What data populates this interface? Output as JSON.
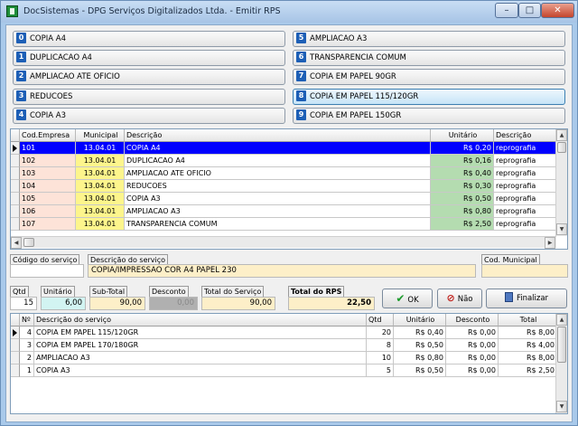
{
  "window": {
    "title": "DocSistemas - DPG Serviços Digitalizados Ltda. - Emitir RPS",
    "min_glyph": "–",
    "max_glyph": "□",
    "close_glyph": "✕"
  },
  "service_buttons": [
    {
      "num": "0",
      "label": "COPIA A4"
    },
    {
      "num": "1",
      "label": "DUPLICACAO A4"
    },
    {
      "num": "2",
      "label": "AMPLIACAO ATE OFICIO"
    },
    {
      "num": "3",
      "label": "REDUCOES"
    },
    {
      "num": "4",
      "label": "COPIA A3"
    },
    {
      "num": "5",
      "label": "AMPLIACAO A3"
    },
    {
      "num": "6",
      "label": "TRANSPARENCIA COMUM"
    },
    {
      "num": "7",
      "label": "COPIA EM PAPEL 90GR"
    },
    {
      "num": "8",
      "label": "COPIA EM PAPEL 115/120GR"
    },
    {
      "num": "9",
      "label": "COPIA EM PAPEL 150GR"
    }
  ],
  "services_grid": {
    "headers": [
      "Cod.Empresa",
      "Municipal",
      "Descrição",
      "Unitário",
      "Descrição"
    ],
    "rows": [
      {
        "cod": "101",
        "mun": "13.04.01",
        "desc": "COPIA A4",
        "unit": "R$ 0,20",
        "cat": "reprografia"
      },
      {
        "cod": "102",
        "mun": "13.04.01",
        "desc": "DUPLICACAO A4",
        "unit": "R$ 0,16",
        "cat": "reprografia"
      },
      {
        "cod": "103",
        "mun": "13.04.01",
        "desc": "AMPLIACAO ATE OFICIO",
        "unit": "R$ 0,40",
        "cat": "reprografia"
      },
      {
        "cod": "104",
        "mun": "13.04.01",
        "desc": "REDUCOES",
        "unit": "R$ 0,30",
        "cat": "reprografia"
      },
      {
        "cod": "105",
        "mun": "13.04.01",
        "desc": "COPIA A3",
        "unit": "R$ 0,50",
        "cat": "reprografia"
      },
      {
        "cod": "106",
        "mun": "13.04.01",
        "desc": "AMPLIACAO A3",
        "unit": "R$ 0,80",
        "cat": "reprografia"
      },
      {
        "cod": "107",
        "mun": "13.04.01",
        "desc": "TRANSPARENCIA COMUM",
        "unit": "R$ 2,50",
        "cat": "reprografia"
      }
    ]
  },
  "form": {
    "codigo_label": "Código do serviço",
    "codigo_value": "",
    "descricao_label": "Descrição do serviço",
    "descricao_value": "COPIA/IMPRESSAO COR A4 PAPEL 230",
    "cod_municipal_label": "Cod. Municipal",
    "cod_municipal_value": "",
    "qtd_label": "Qtd",
    "qtd_value": "15",
    "unitario_label": "Unitário",
    "unitario_value": "6,00",
    "subtotal_label": "Sub-Total",
    "subtotal_value": "90,00",
    "desconto_label": "Desconto",
    "desconto_value": "0,00",
    "total_servico_label": "Total do Serviço",
    "total_servico_value": "90,00",
    "total_rps_label": "Total do RPS",
    "total_rps_value": "22,50"
  },
  "actions": {
    "ok": "OK",
    "nao": "Não",
    "finalizar": "Finalizar"
  },
  "items_grid": {
    "headers": [
      "Nº",
      "Descrição do serviço",
      "Qtd",
      "Unitário",
      "Desconto",
      "Total"
    ],
    "rows": [
      {
        "n": "4",
        "desc": "COPIA EM PAPEL 115/120GR",
        "qtd": "20",
        "unit": "R$ 0,40",
        "desc_val": "R$ 0,00",
        "total": "R$ 8,00"
      },
      {
        "n": "3",
        "desc": "COPIA EM PAPEL 170/180GR",
        "qtd": "8",
        "unit": "R$ 0,50",
        "desc_val": "R$ 0,00",
        "total": "R$ 4,00"
      },
      {
        "n": "2",
        "desc": "AMPLIACAO A3",
        "qtd": "10",
        "unit": "R$ 0,80",
        "desc_val": "R$ 0,00",
        "total": "R$ 8,00"
      },
      {
        "n": "1",
        "desc": "COPIA A3",
        "qtd": "5",
        "unit": "R$ 0,50",
        "desc_val": "R$ 0,00",
        "total": "R$ 2,50"
      }
    ]
  },
  "colors": {
    "selected_row": "#0000ff",
    "cod_cell": "#fde3d8",
    "municipal_cell": "#fdf58c",
    "unit_cell": "#b4dcb0",
    "form_field": "#fdefc8",
    "unitario_field": "#d2f4f2",
    "number_badge": "#1d5fb6"
  }
}
